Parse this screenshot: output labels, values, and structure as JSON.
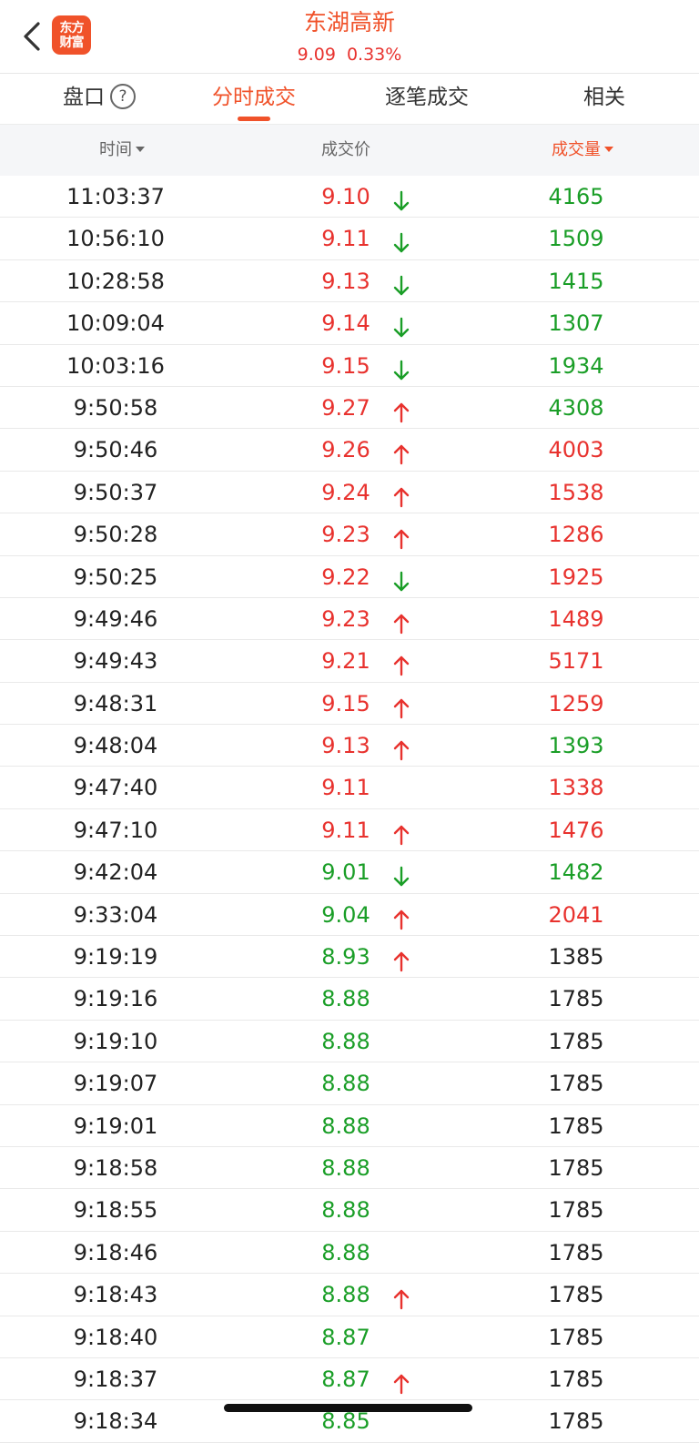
{
  "header": {
    "title": "东湖高新",
    "price": "9.09",
    "change_pct": "0.33%",
    "logo_text": [
      "东方",
      "财富"
    ]
  },
  "tabs": [
    {
      "label": "盘口",
      "active": false,
      "has_help": true
    },
    {
      "label": "分时成交",
      "active": true
    },
    {
      "label": "逐笔成交",
      "active": false
    },
    {
      "label": "相关",
      "active": false
    }
  ],
  "columns": {
    "time": "时间",
    "price": "成交价",
    "volume": "成交量"
  },
  "colors": {
    "accent": "#f0522a",
    "up": "#e8322e",
    "down": "#1a9e27"
  },
  "trades": [
    {
      "time": "11:03:37",
      "price": "9.10",
      "price_color": "red",
      "dir": "down",
      "volume": "4165",
      "vol_color": "green"
    },
    {
      "time": "10:56:10",
      "price": "9.11",
      "price_color": "red",
      "dir": "down",
      "volume": "1509",
      "vol_color": "green"
    },
    {
      "time": "10:28:58",
      "price": "9.13",
      "price_color": "red",
      "dir": "down",
      "volume": "1415",
      "vol_color": "green"
    },
    {
      "time": "10:09:04",
      "price": "9.14",
      "price_color": "red",
      "dir": "down",
      "volume": "1307",
      "vol_color": "green"
    },
    {
      "time": "10:03:16",
      "price": "9.15",
      "price_color": "red",
      "dir": "down",
      "volume": "1934",
      "vol_color": "green"
    },
    {
      "time": "9:50:58",
      "price": "9.27",
      "price_color": "red",
      "dir": "up",
      "volume": "4308",
      "vol_color": "green"
    },
    {
      "time": "9:50:46",
      "price": "9.26",
      "price_color": "red",
      "dir": "up",
      "volume": "4003",
      "vol_color": "red"
    },
    {
      "time": "9:50:37",
      "price": "9.24",
      "price_color": "red",
      "dir": "up",
      "volume": "1538",
      "vol_color": "red"
    },
    {
      "time": "9:50:28",
      "price": "9.23",
      "price_color": "red",
      "dir": "up",
      "volume": "1286",
      "vol_color": "red"
    },
    {
      "time": "9:50:25",
      "price": "9.22",
      "price_color": "red",
      "dir": "down",
      "volume": "1925",
      "vol_color": "red"
    },
    {
      "time": "9:49:46",
      "price": "9.23",
      "price_color": "red",
      "dir": "up",
      "volume": "1489",
      "vol_color": "red"
    },
    {
      "time": "9:49:43",
      "price": "9.21",
      "price_color": "red",
      "dir": "up",
      "volume": "5171",
      "vol_color": "red"
    },
    {
      "time": "9:48:31",
      "price": "9.15",
      "price_color": "red",
      "dir": "up",
      "volume": "1259",
      "vol_color": "red"
    },
    {
      "time": "9:48:04",
      "price": "9.13",
      "price_color": "red",
      "dir": "up",
      "volume": "1393",
      "vol_color": "green"
    },
    {
      "time": "9:47:40",
      "price": "9.11",
      "price_color": "red",
      "dir": "",
      "volume": "1338",
      "vol_color": "red"
    },
    {
      "time": "9:47:10",
      "price": "9.11",
      "price_color": "red",
      "dir": "up",
      "volume": "1476",
      "vol_color": "red"
    },
    {
      "time": "9:42:04",
      "price": "9.01",
      "price_color": "green",
      "dir": "down",
      "volume": "1482",
      "vol_color": "green"
    },
    {
      "time": "9:33:04",
      "price": "9.04",
      "price_color": "green",
      "dir": "up",
      "volume": "2041",
      "vol_color": "red"
    },
    {
      "time": "9:19:19",
      "price": "8.93",
      "price_color": "green",
      "dir": "up",
      "volume": "1385",
      "vol_color": "black"
    },
    {
      "time": "9:19:16",
      "price": "8.88",
      "price_color": "green",
      "dir": "",
      "volume": "1785",
      "vol_color": "black"
    },
    {
      "time": "9:19:10",
      "price": "8.88",
      "price_color": "green",
      "dir": "",
      "volume": "1785",
      "vol_color": "black"
    },
    {
      "time": "9:19:07",
      "price": "8.88",
      "price_color": "green",
      "dir": "",
      "volume": "1785",
      "vol_color": "black"
    },
    {
      "time": "9:19:01",
      "price": "8.88",
      "price_color": "green",
      "dir": "",
      "volume": "1785",
      "vol_color": "black"
    },
    {
      "time": "9:18:58",
      "price": "8.88",
      "price_color": "green",
      "dir": "",
      "volume": "1785",
      "vol_color": "black"
    },
    {
      "time": "9:18:55",
      "price": "8.88",
      "price_color": "green",
      "dir": "",
      "volume": "1785",
      "vol_color": "black"
    },
    {
      "time": "9:18:46",
      "price": "8.88",
      "price_color": "green",
      "dir": "",
      "volume": "1785",
      "vol_color": "black"
    },
    {
      "time": "9:18:43",
      "price": "8.88",
      "price_color": "green",
      "dir": "up",
      "volume": "1785",
      "vol_color": "black"
    },
    {
      "time": "9:18:40",
      "price": "8.87",
      "price_color": "green",
      "dir": "",
      "volume": "1785",
      "vol_color": "black"
    },
    {
      "time": "9:18:37",
      "price": "8.87",
      "price_color": "green",
      "dir": "up",
      "volume": "1785",
      "vol_color": "black"
    },
    {
      "time": "9:18:34",
      "price": "8.85",
      "price_color": "green",
      "dir": "",
      "volume": "1785",
      "vol_color": "black"
    }
  ]
}
